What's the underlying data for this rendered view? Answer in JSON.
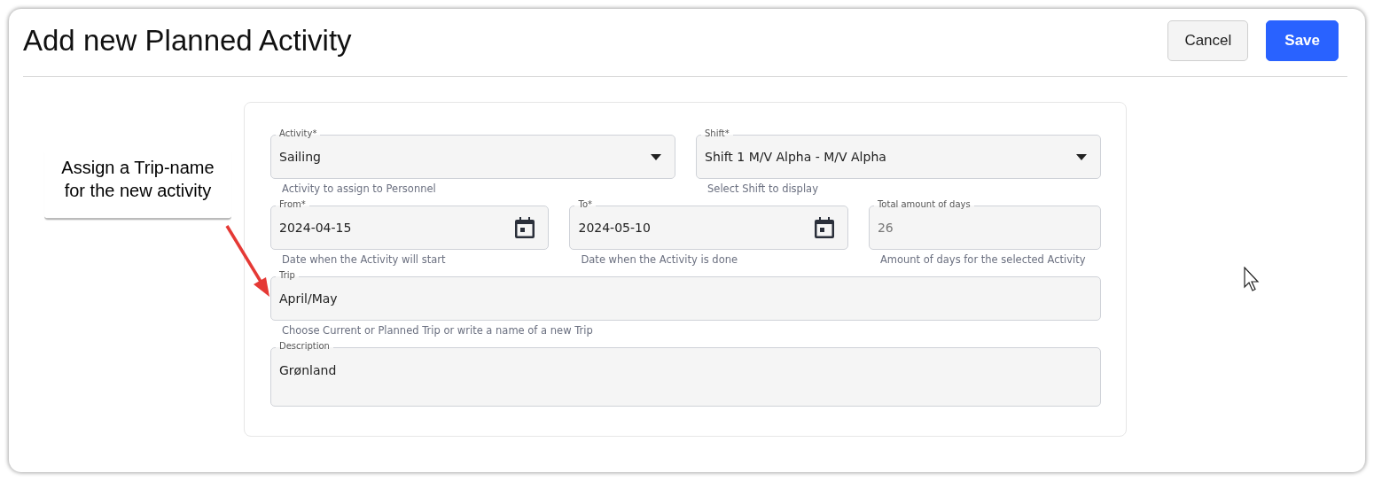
{
  "title": "Add new Planned Activity",
  "buttons": [
    {
      "label": "Cancel",
      "kind": "secondary"
    },
    {
      "label": "Save",
      "kind": "primary"
    }
  ],
  "callout": {
    "text": "Assign a Trip-name for the new activity"
  },
  "rows": [
    [
      {
        "kind": "select",
        "label": "Activity*",
        "value": "Sailing",
        "hint": "Activity to assign to Personnel"
      },
      {
        "kind": "select",
        "label": "Shift*",
        "value": "Shift 1 M/V Alpha - M/V Alpha",
        "hint": "Select Shift to display"
      }
    ],
    [
      {
        "kind": "date",
        "label": "From*",
        "value": "2024-04-15",
        "hint": "Date when the Activity will start"
      },
      {
        "kind": "date",
        "label": "To*",
        "value": "2024-05-10",
        "hint": "Date when the Activity is done"
      },
      {
        "kind": "readonly",
        "label": "Total amount of days",
        "value": "26",
        "hint": "Amount of days for the selected Activity"
      }
    ],
    [
      {
        "kind": "text",
        "label": "Trip",
        "value": "April/May",
        "hint": "Choose Current or Planned Trip or write a name of a new Trip"
      }
    ],
    [
      {
        "kind": "textarea",
        "label": "Description",
        "value": "Grønland"
      }
    ]
  ]
}
